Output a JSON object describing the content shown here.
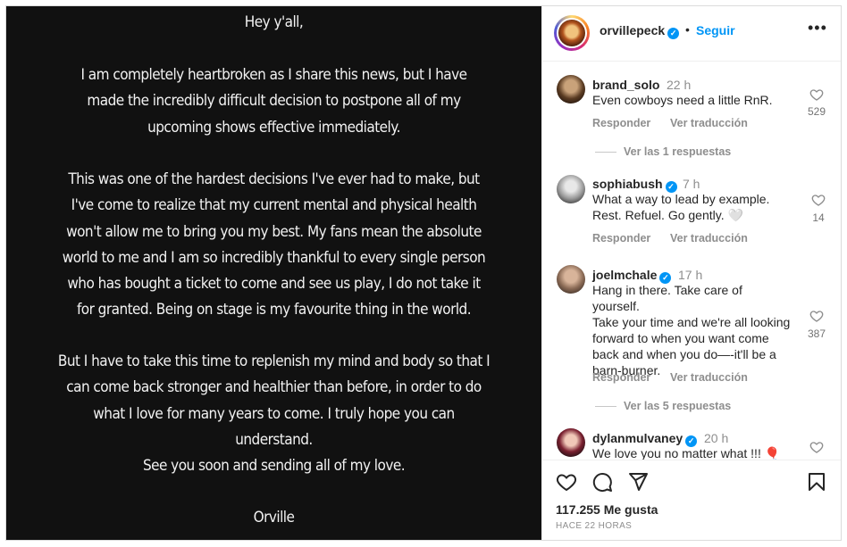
{
  "post": {
    "paragraphs": [
      "Hey y'all,",
      "I am completely heartbroken as I share this news, but I have made the incredibly difficult decision to postpone all of my upcoming shows effective immediately.",
      "This was one of the hardest decisions I've ever had to make, but I've come to realize that my current mental and physical health won't allow me to bring you my best. My fans mean the absolute world to me and I am so incredibly thankful to every single person who has bought a ticket to come and see us play, I do not take it for granted. Being on stage is my favourite thing in the world.",
      "But I have to take this time to replenish my mind and body so that I can come back stronger and healthier than before, in order to do what I love for many years to come. I truly hope you can understand.",
      "See you soon and sending all of my love.",
      "Orville"
    ]
  },
  "header": {
    "username": "orvillepeck",
    "separator": "•",
    "follow_label": "Seguir",
    "more_label": "•••"
  },
  "comments": [
    {
      "username": "brand_solo",
      "time": "22 h",
      "verified": false,
      "lines": [
        "Even cowboys need a little RnR."
      ],
      "reply_label": "Responder",
      "translate_label": "Ver traducción",
      "likes": "529",
      "view_replies": "Ver las 1 respuestas"
    },
    {
      "username": "sophiabush",
      "time": "7 h",
      "verified": true,
      "lines": [
        "What a way to lead by example.",
        "Rest. Refuel. Go gently. 🤍"
      ],
      "reply_label": "Responder",
      "translate_label": "Ver traducción",
      "likes": "14"
    },
    {
      "username": "joelmchale",
      "time": "17 h",
      "verified": true,
      "lines": [
        "Hang in there. Take care of yourself.",
        "Take your time and we're all looking",
        "forward to when you want come",
        "back and when you do—-it'll be a",
        "barn-burner."
      ],
      "reply_label": "Responder",
      "translate_label": "Ver traducción",
      "likes": "387",
      "view_replies": "Ver las 5 respuestas"
    },
    {
      "username": "dylanmulvaney",
      "time": "20 h",
      "verified": true,
      "lines": [
        "We love you no matter what !!! 🎈"
      ]
    }
  ],
  "footer": {
    "likes_total": "117.255 Me gusta",
    "posted_ago": "HACE 22 HORAS"
  },
  "colors": {
    "accent": "#0095f6",
    "image_bg": "#111111",
    "muted": "#8e8e8e"
  }
}
